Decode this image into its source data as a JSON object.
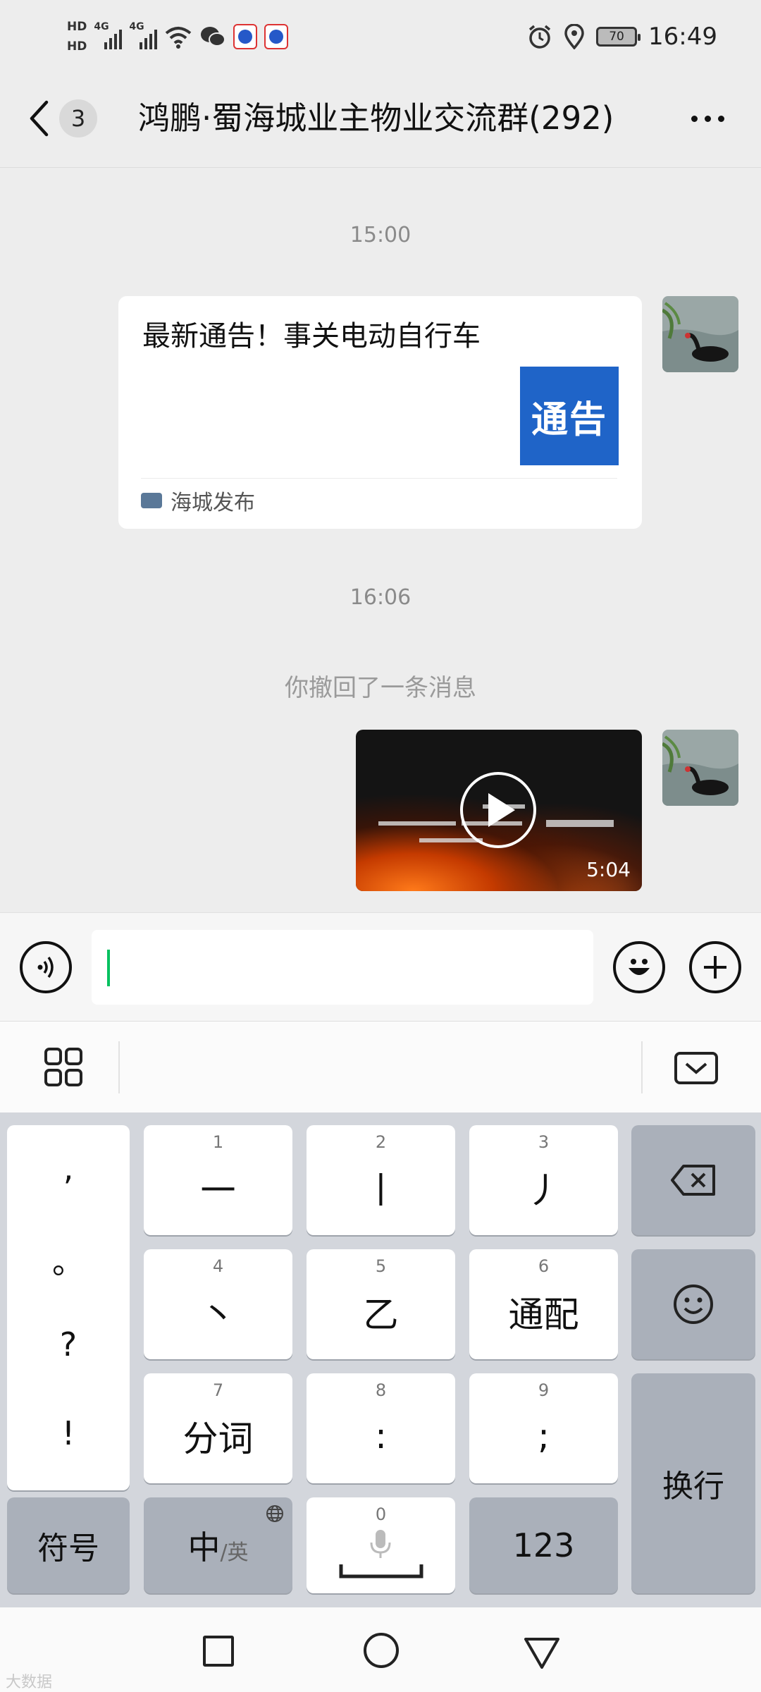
{
  "status_bar": {
    "hd1": "HD",
    "hd2": "HD",
    "sim1_net": "4G",
    "sim2_net": "4G",
    "battery": "70",
    "time": "16:49"
  },
  "header": {
    "unread_count": "3",
    "title": "鸿鹏·蜀海城业主物业交流群(292)"
  },
  "messages": {
    "time1": "15:00",
    "card_title": "最新通告！事关电动自行车",
    "card_thumb_text": "通告",
    "card_source": "海城发布",
    "time2": "16:06",
    "recall": "你撤回了一条消息",
    "video_duration": "5:04"
  },
  "keyboard": {
    "punct": [
      ",",
      "。",
      "?",
      "!"
    ],
    "keys": [
      {
        "num": "1",
        "label": "一"
      },
      {
        "num": "2",
        "label": "丨"
      },
      {
        "num": "3",
        "label": "丿"
      },
      {
        "num": "4",
        "label": "丶"
      },
      {
        "num": "5",
        "label": "乙"
      },
      {
        "num": "6",
        "label": "通配"
      },
      {
        "num": "7",
        "label": "分词"
      },
      {
        "num": "8",
        "label": ":"
      },
      {
        "num": "9",
        "label": ";"
      }
    ],
    "symbols": "符号",
    "chinese": "中",
    "english": "/英",
    "space_num": "0",
    "num_key": "123",
    "enter": "换行"
  },
  "watermark": "大数据",
  "colors": {
    "accent": "#07c160",
    "notice_blue": "#1f64c8"
  }
}
